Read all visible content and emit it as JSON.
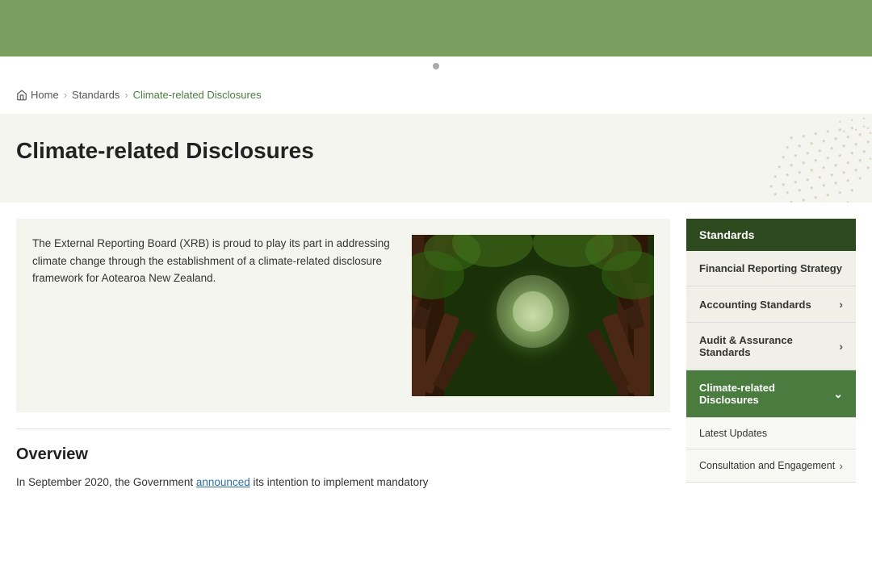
{
  "topBanner": {},
  "breadcrumb": {
    "home": "Home",
    "separator1": "›",
    "standards": "Standards",
    "separator2": "›",
    "current": "Climate-related Disclosures"
  },
  "pageHeader": {
    "title": "Climate-related Disclosures"
  },
  "introCard": {
    "text": "The External Reporting Board (XRB) is proud to play its part in addressing climate change through the establishment of a climate-related disclosure framework for Aotearoa New Zealand."
  },
  "overview": {
    "title": "Overview",
    "text": "In September 2020, the Government ",
    "linkText": "announced",
    "textAfter": " its intention to implement mandatory"
  },
  "sidebar": {
    "header": "Standards",
    "items": [
      {
        "label": "Financial Reporting Strategy",
        "hasChevron": true,
        "active": false,
        "isSubItem": false
      },
      {
        "label": "Accounting Standards",
        "hasChevron": true,
        "active": false,
        "isSubItem": false
      },
      {
        "label": "Audit & Assurance Standards",
        "hasChevron": true,
        "active": false,
        "isSubItem": false
      },
      {
        "label": "Climate-related Disclosures",
        "hasChevron": true,
        "active": true,
        "isSubItem": false
      },
      {
        "label": "Latest Updates",
        "hasChevron": false,
        "active": false,
        "isSubItem": true
      },
      {
        "label": "Consultation and Engagement",
        "hasChevron": true,
        "active": false,
        "isSubItem": true
      }
    ]
  },
  "colors": {
    "topBanner": "#7a9e5f",
    "sidebarHeader": "#2d4a1e",
    "activeItem": "#4a7c3f",
    "breadcrumbCurrent": "#4a7c3f"
  }
}
